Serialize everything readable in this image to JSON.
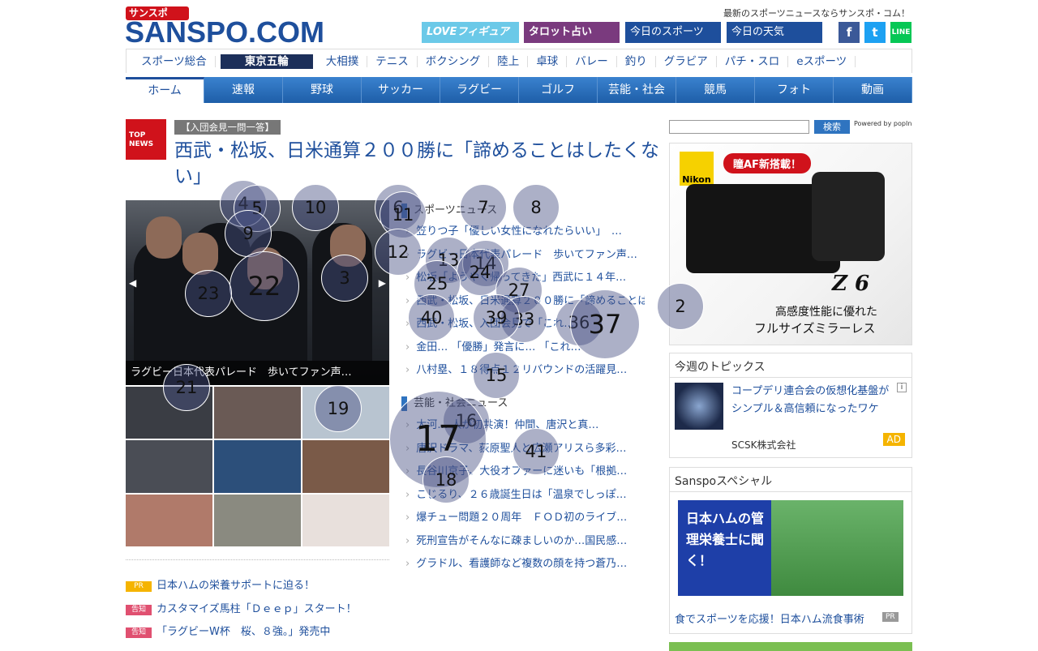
{
  "header": {
    "logo_kicker": "サンスポ",
    "logo": "SANSPO.COM",
    "tagline": "最新のスポーツニュースならサンスポ・コム！",
    "buttons": [
      "LOVEフィギュア",
      "タロット占い",
      "今日のスポーツ",
      "今日の天気"
    ],
    "social": [
      "f",
      "t",
      "LINE"
    ]
  },
  "subnav": [
    "スポーツ総合",
    "東京五輪",
    "大相撲",
    "テニス",
    "ボクシング",
    "陸上",
    "卓球",
    "バレー",
    "釣り",
    "グラビア",
    "パチ・スロ",
    "eスポーツ"
  ],
  "mainnav": [
    "ホーム",
    "速報",
    "野球",
    "サッカー",
    "ラグビー",
    "ゴルフ",
    "芸能・社会",
    "競馬",
    "フォト",
    "動画"
  ],
  "top_news": {
    "badge": "TOP NEWS",
    "tag": "【入団会見一問一答】",
    "headline": "西武・松坂、日米通算２００勝に「諦めることはしたくない」",
    "hero_caption": "ラグビー日本代表パレード　歩いてファン声…"
  },
  "sports_list": {
    "heading": "スポーツニュース",
    "items": [
      "笠りつ子「優しい女性になれたらいい」　…",
      "ラグビー日本代表パレード　歩いてファン声…",
      "松坂「ようやく帰ってきた」西武に１４年…",
      "西武・松坂、日米通算２００勝に「諦めることは…",
      "西武・松坂、入団会見で「これ…",
      "金田… 「優勝」発言に… 「これ…",
      "八村塁、１８得点１２リバウンドの活躍見…"
    ]
  },
  "entertainment_list": {
    "heading": "芸能・社会ニュース",
    "items": [
      "大河… 人が初共演！仲間、唐沢と真…",
      "唐沢ドラマ、荻原聖人と広瀬アリスら多彩…",
      "長谷川京子、大役オファーに迷いも「根拠…",
      "こじるり、２６歳誕生日は「温泉でしっぽ…",
      "爆チュー問題２０周年　ＦＯＤ初のライブ…",
      "死刑宣告がそんなに疎ましいのか…国民感…",
      "グラドル、看護師など複数の顔を持つ蒼乃…"
    ]
  },
  "pr_links": [
    {
      "tag": "PR",
      "text": "日本ハムの栄養サポートに迫る！"
    },
    {
      "tag": "告知",
      "text": "カスタマイズ馬柱「Ｄｅｅｐ」スタート！"
    },
    {
      "tag": "告知",
      "text": "「ラグビーW杯　桜、８強。」発売中"
    }
  ],
  "search": {
    "placeholder": "",
    "button": "検索",
    "powered": "Powered by popIn"
  },
  "nikon_ad": {
    "brand": "Nikon",
    "promo": "瞳AF新搭載！",
    "model": "Z 6",
    "copy1": "高感度性能に優れた",
    "copy2": "フルサイズミラーレス"
  },
  "topics": {
    "title": "今週のトピックス",
    "headline": "コープデリ連合会の仮想化基盤がシンプル＆高信頼になったワケ",
    "sponsor": "SCSK株式会社",
    "ad_label": "AD",
    "info": "i"
  },
  "special": {
    "title": "Sanspoスペシャル",
    "banner_text": "日本ハムの管理栄養士に聞く！",
    "link": "食でスポーツを応援！日本ハム流食事術",
    "pr": "PR"
  },
  "markers": [
    "2",
    "3",
    "4",
    "5",
    "6",
    "7",
    "8",
    "9",
    "10",
    "11",
    "12",
    "13",
    "14",
    "15",
    "16",
    "17",
    "18",
    "19",
    "21",
    "22",
    "23",
    "24",
    "25",
    "27",
    "33",
    "36",
    "37",
    "39",
    "40",
    "41"
  ]
}
